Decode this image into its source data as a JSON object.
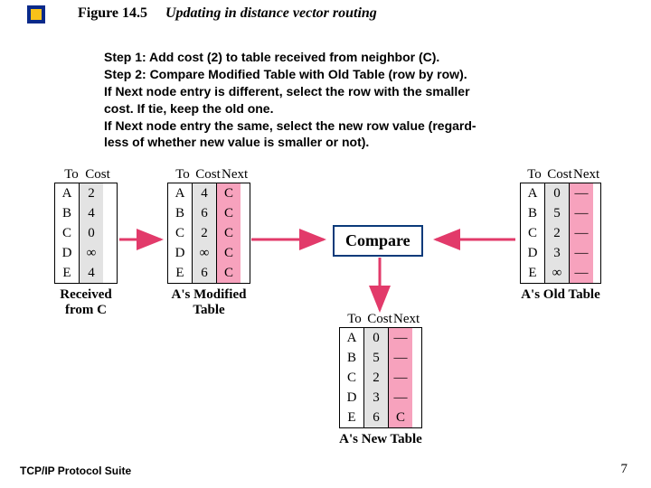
{
  "figure": {
    "label": "Figure 14.5",
    "title": "Updating in distance vector routing"
  },
  "steps": {
    "l1": "Step 1: Add cost (2) to table received from neighbor (C).",
    "l2": "Step 2: Compare Modified Table with Old Table (row by row).",
    "l3": "If Next node entry is different, select the row with the smaller",
    "l4": "cost.  If tie, keep the old one.",
    "l5": "If Next node entry the same, select the new row value (regard-",
    "l6": "less of whether new value is smaller or not)."
  },
  "headers": {
    "to": "To",
    "cost": "Cost",
    "next": "Next"
  },
  "tables": {
    "received": {
      "caption": "Received from C",
      "to": [
        "A",
        "B",
        "C",
        "D",
        "E"
      ],
      "cost": [
        "2",
        "4",
        "0",
        "∞",
        "4"
      ]
    },
    "modified": {
      "caption": "A's Modified Table",
      "to": [
        "A",
        "B",
        "C",
        "D",
        "E"
      ],
      "cost": [
        "4",
        "6",
        "2",
        "∞",
        "6"
      ],
      "next": [
        "C",
        "C",
        "C",
        "C",
        "C"
      ]
    },
    "old": {
      "caption": "A's Old Table",
      "to": [
        "A",
        "B",
        "C",
        "D",
        "E"
      ],
      "cost": [
        "0",
        "5",
        "2",
        "3",
        "∞"
      ],
      "next": [
        "—",
        "—",
        "—",
        "—",
        "—"
      ]
    },
    "newt": {
      "caption": "A's New Table",
      "to": [
        "A",
        "B",
        "C",
        "D",
        "E"
      ],
      "cost": [
        "0",
        "5",
        "2",
        "3",
        "6"
      ],
      "next": [
        "—",
        "—",
        "—",
        "—",
        "C"
      ]
    }
  },
  "compare": "Compare",
  "footer": {
    "left": "TCP/IP Protocol Suite",
    "right": "7"
  },
  "chart_data": {
    "type": "table",
    "title": "Updating in distance vector routing",
    "tables": [
      {
        "name": "Received from C",
        "columns": [
          "To",
          "Cost"
        ],
        "rows": [
          [
            "A",
            2
          ],
          [
            "B",
            4
          ],
          [
            "C",
            0
          ],
          [
            "D",
            "∞"
          ],
          [
            "E",
            4
          ]
        ]
      },
      {
        "name": "A's Modified Table",
        "columns": [
          "To",
          "Cost",
          "Next"
        ],
        "rows": [
          [
            "A",
            4,
            "C"
          ],
          [
            "B",
            6,
            "C"
          ],
          [
            "C",
            2,
            "C"
          ],
          [
            "D",
            "∞",
            "C"
          ],
          [
            "E",
            6,
            "C"
          ]
        ]
      },
      {
        "name": "A's Old Table",
        "columns": [
          "To",
          "Cost",
          "Next"
        ],
        "rows": [
          [
            "A",
            0,
            "—"
          ],
          [
            "B",
            5,
            "—"
          ],
          [
            "C",
            2,
            "—"
          ],
          [
            "D",
            3,
            "—"
          ],
          [
            "E",
            "∞",
            "—"
          ]
        ]
      },
      {
        "name": "A's New Table",
        "columns": [
          "To",
          "Cost",
          "Next"
        ],
        "rows": [
          [
            "A",
            0,
            "—"
          ],
          [
            "B",
            5,
            "—"
          ],
          [
            "C",
            2,
            "—"
          ],
          [
            "D",
            3,
            "—"
          ],
          [
            "E",
            6,
            "C"
          ]
        ]
      }
    ]
  }
}
